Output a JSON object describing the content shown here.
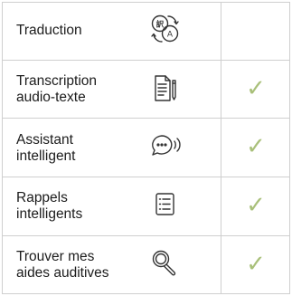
{
  "features": [
    {
      "label": "Traduction",
      "icon": "translate-icon",
      "available": false
    },
    {
      "label": "Transcription\naudio-texte",
      "icon": "transcription-icon",
      "available": true
    },
    {
      "label": "Assistant\nintelligent",
      "icon": "assistant-icon",
      "available": true
    },
    {
      "label": "Rappels\nintelligents",
      "icon": "reminders-icon",
      "available": true
    },
    {
      "label": "Trouver mes\naides auditives",
      "icon": "search-icon",
      "available": true
    }
  ],
  "check_glyph": "✓",
  "colors": {
    "grid": "#cfcfcf",
    "check": "#a9c07a",
    "text": "#1c1c1c",
    "icon": "#333333"
  }
}
